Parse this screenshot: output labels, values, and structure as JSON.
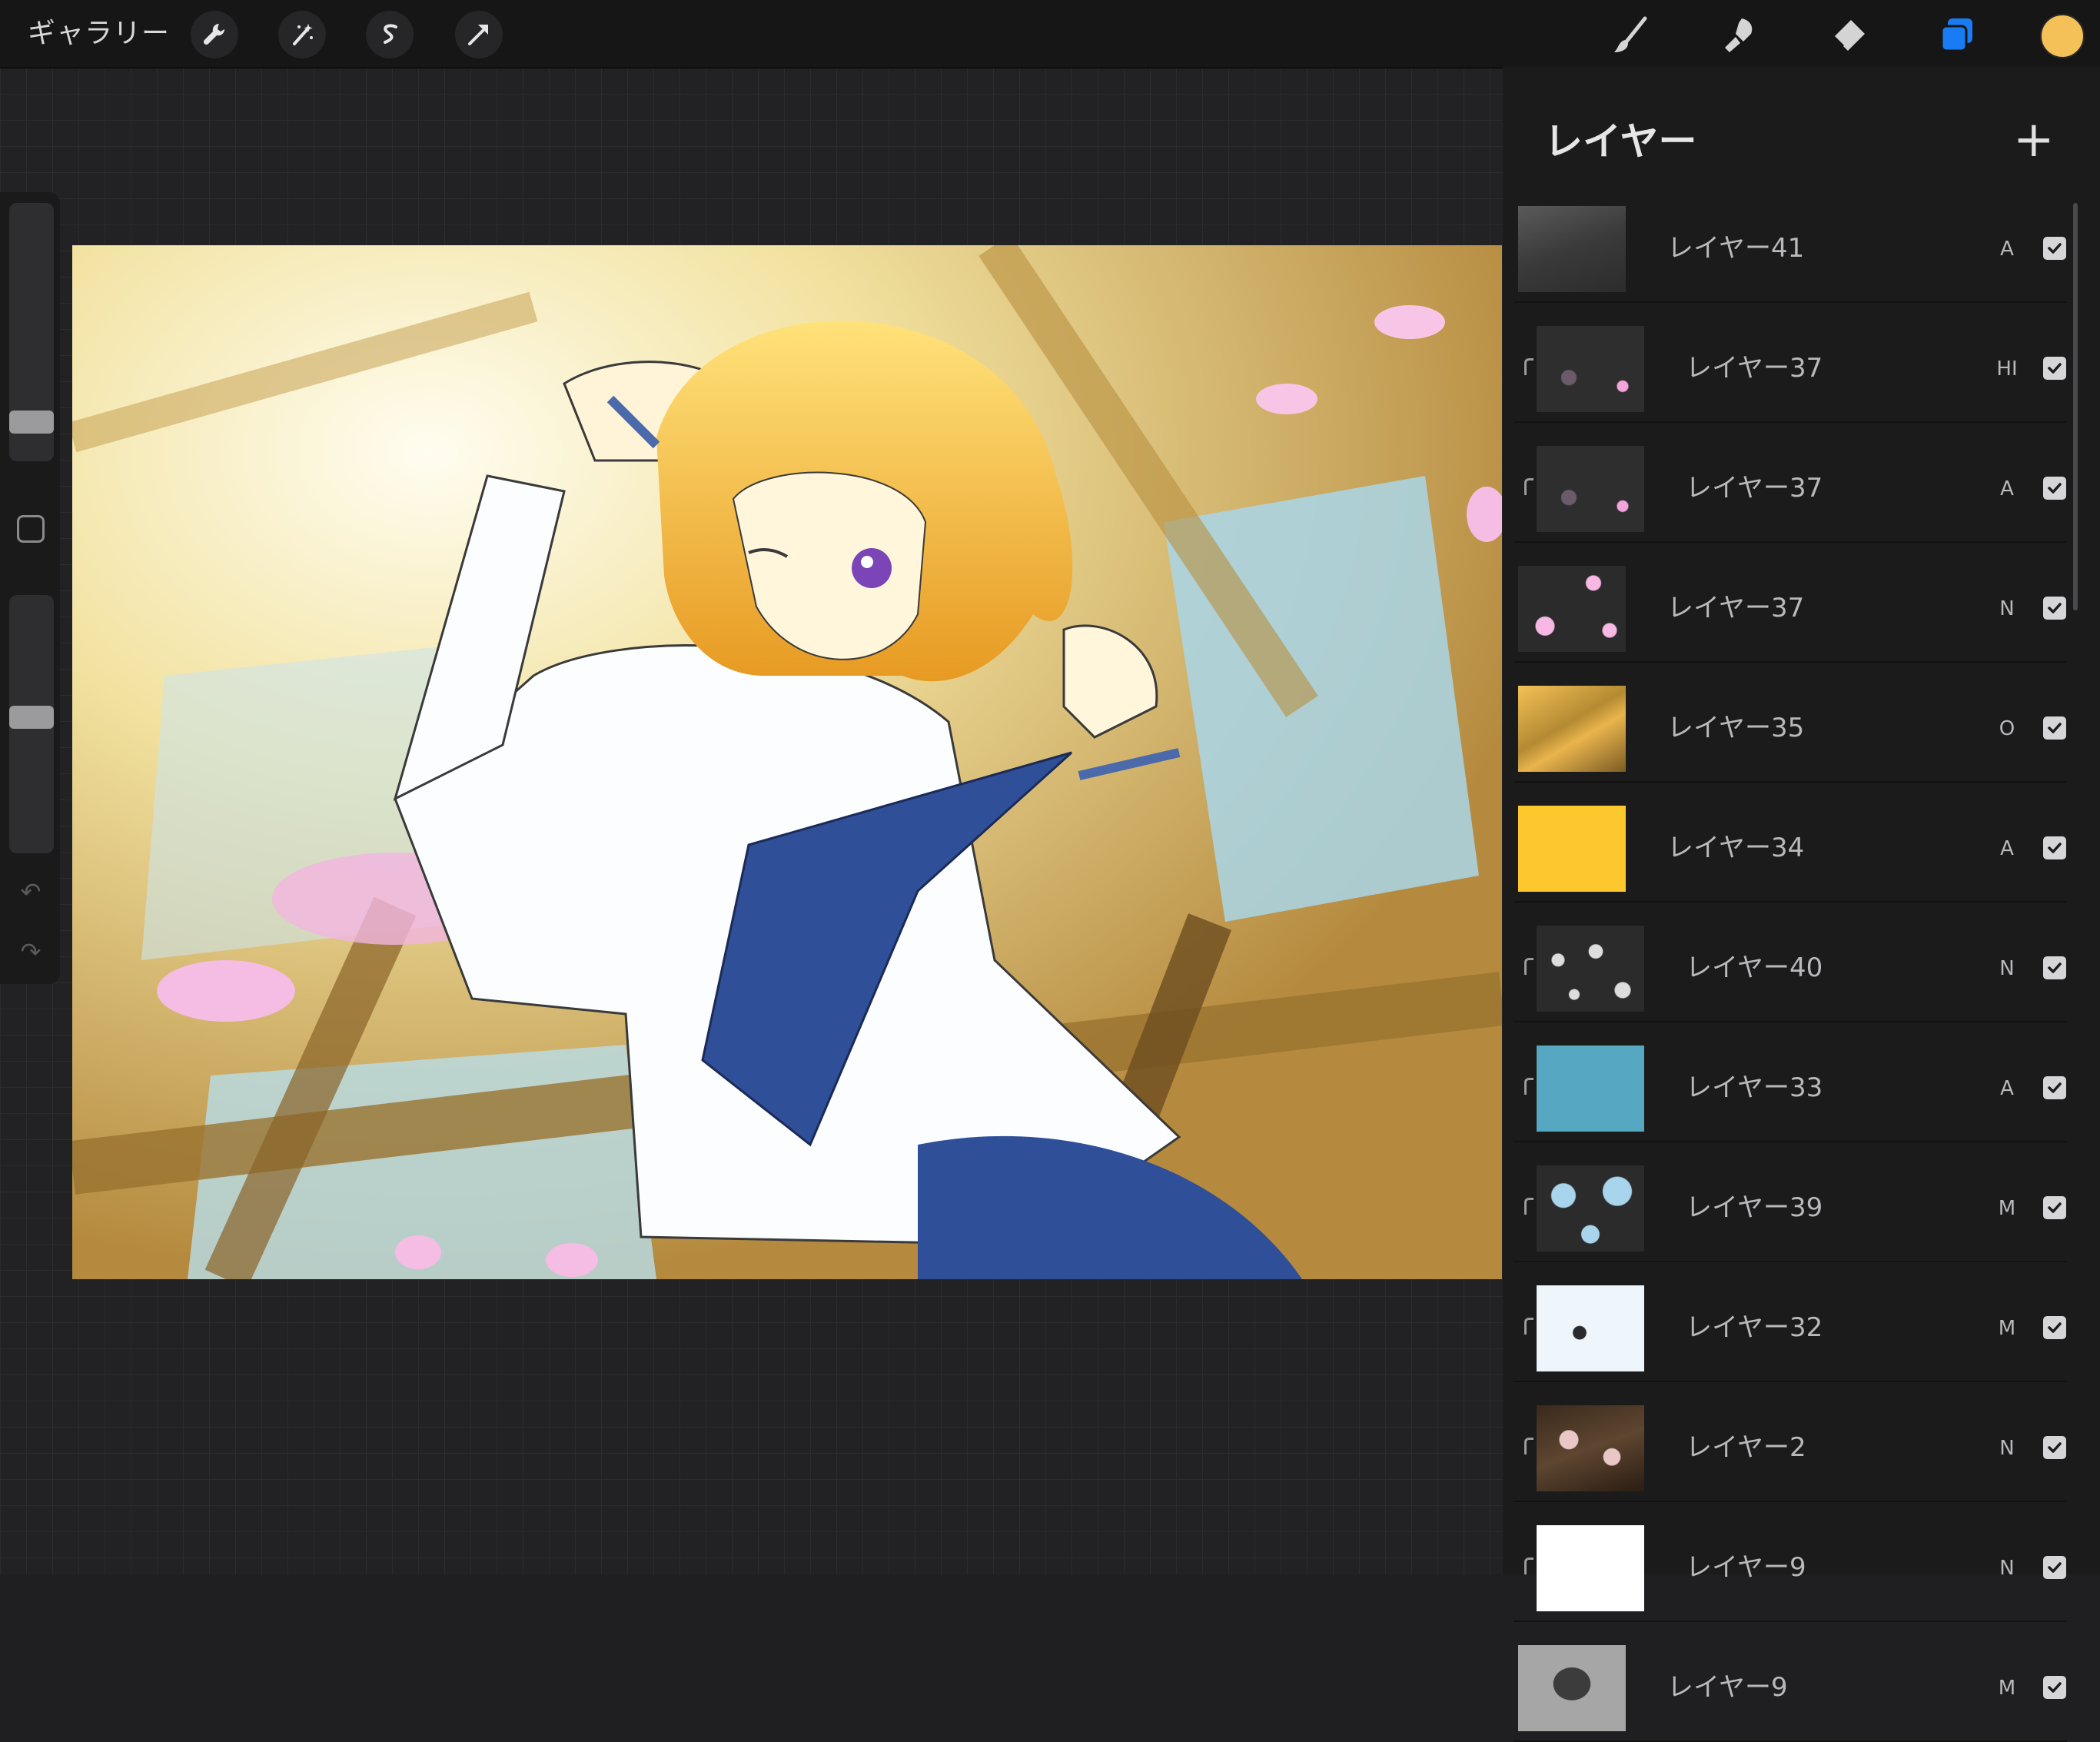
{
  "toolbar": {
    "gallery_label": "ギャラリー",
    "left_tools": [
      "wrench-icon",
      "magic-wand-icon",
      "selection-s-icon",
      "transform-arrow-icon"
    ],
    "right_tools": [
      "brush-icon",
      "smudge-icon",
      "eraser-icon",
      "layers-icon"
    ],
    "active_color": "#f3c158",
    "accent_color": "#1a7cf5"
  },
  "sidebar": {
    "brush_size_level": 0.08,
    "opacity_level": 0.52
  },
  "layers_panel": {
    "title": "レイヤー",
    "add_label": "+",
    "layers": [
      {
        "name": "レイヤー41",
        "mode": "A",
        "visible": true,
        "clipped": false,
        "thumb": "dark-smoke"
      },
      {
        "name": "レイヤー37",
        "mode": "HI",
        "visible": true,
        "clipped": true,
        "thumb": "dark-petals"
      },
      {
        "name": "レイヤー37",
        "mode": "A",
        "visible": true,
        "clipped": true,
        "thumb": "dark-petals"
      },
      {
        "name": "レイヤー37",
        "mode": "N",
        "visible": true,
        "clipped": false,
        "thumb": "pink-petals"
      },
      {
        "name": "レイヤー35",
        "mode": "O",
        "visible": true,
        "clipped": false,
        "thumb": "gold-branches"
      },
      {
        "name": "レイヤー34",
        "mode": "A",
        "visible": true,
        "clipped": false,
        "thumb": "solid-yellow"
      },
      {
        "name": "レイヤー40",
        "mode": "N",
        "visible": true,
        "clipped": true,
        "thumb": "white-splatter"
      },
      {
        "name": "レイヤー33",
        "mode": "A",
        "visible": true,
        "clipped": true,
        "thumb": "solid-teal"
      },
      {
        "name": "レイヤー39",
        "mode": "M",
        "visible": true,
        "clipped": true,
        "thumb": "blue-shapes"
      },
      {
        "name": "レイヤー32",
        "mode": "M",
        "visible": true,
        "clipped": true,
        "thumb": "white-sky"
      },
      {
        "name": "レイヤー2",
        "mode": "N",
        "visible": true,
        "clipped": true,
        "thumb": "blossom-branch"
      },
      {
        "name": "レイヤー9",
        "mode": "N",
        "visible": true,
        "clipped": true,
        "thumb": "solid-white"
      },
      {
        "name": "レイヤー9",
        "mode": "M",
        "visible": true,
        "clipped": false,
        "thumb": "grey-silhouette"
      }
    ]
  }
}
